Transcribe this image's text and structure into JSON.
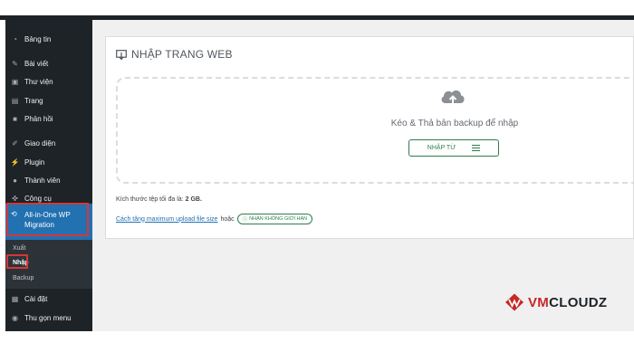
{
  "sidebar": {
    "items": [
      {
        "label": "Bảng tin",
        "icon": "dashboard-icon"
      },
      {
        "label": "Bài viết",
        "icon": "pin-icon"
      },
      {
        "label": "Thư viện",
        "icon": "media-icon"
      },
      {
        "label": "Trang",
        "icon": "page-icon"
      },
      {
        "label": "Phản hồi",
        "icon": "comment-icon"
      },
      {
        "label": "Giao diện",
        "icon": "brush-icon"
      },
      {
        "label": "Plugin",
        "icon": "plugin-icon"
      },
      {
        "label": "Thành viên",
        "icon": "user-icon"
      },
      {
        "label": "Công cụ",
        "icon": "wrench-icon"
      }
    ],
    "active": {
      "label_line1": "All-in-One WP",
      "label_line2": "Migration",
      "icon": "migration-icon"
    },
    "submenu": [
      "Xuất",
      "Nhập",
      "Backup"
    ],
    "bottom": [
      {
        "label": "Cài đặt",
        "icon": "settings-icon"
      },
      {
        "label": "Thu gọn menu",
        "icon": "collapse-icon"
      }
    ]
  },
  "panel": {
    "title": "NHẬP TRANG WEB",
    "drop_text": "Kéo & Thả bản backup để nhập",
    "import_button": "NHẬP TỪ",
    "max_size_label": "Kích thước tệp tối đa là:",
    "max_size_value": "2 GB.",
    "help_link": "Cách tăng maximum upload file size",
    "or_text": "hoặc",
    "unlimited_button": "NHẬN KHÔNG GIỚI HẠN"
  },
  "brand": {
    "prefix": "VM",
    "suffix": "CLOUDZ"
  },
  "colors": {
    "sidebar": "#1d2327",
    "active": "#2271b1",
    "accent_green": "#2e7d4f",
    "highlight_red": "#d63638",
    "brand_red": "#c62828"
  }
}
